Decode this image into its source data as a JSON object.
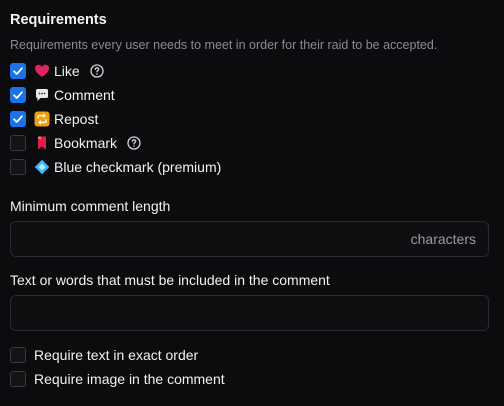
{
  "section": {
    "title": "Requirements",
    "description": "Requirements every user needs to meet in order for their raid to be accepted."
  },
  "requirements": [
    {
      "label": "Like",
      "checked": true,
      "icon": "heart-icon",
      "has_help": true
    },
    {
      "label": "Comment",
      "checked": true,
      "icon": "speech-bubble-icon",
      "has_help": false
    },
    {
      "label": "Repost",
      "checked": true,
      "icon": "repeat-icon",
      "has_help": false
    },
    {
      "label": "Bookmark",
      "checked": false,
      "icon": "bookmark-icon",
      "has_help": true
    },
    {
      "label": "Blue checkmark (premium)",
      "checked": false,
      "icon": "diamond-icon",
      "has_help": false
    }
  ],
  "min_comment": {
    "label": "Minimum comment length",
    "value": "",
    "suffix": "characters"
  },
  "required_text": {
    "label": "Text or words that must be included in the comment",
    "value": ""
  },
  "options": [
    {
      "label": "Require text in exact order",
      "checked": false
    },
    {
      "label": "Require image in the comment",
      "checked": false
    }
  ],
  "colors": {
    "accent": "#1a73e8",
    "background": "#0c0c0e",
    "heart": "#e0245e",
    "repost": "#f59e0b",
    "bookmark": "#e11d48",
    "diamond": "#38bdf8"
  }
}
